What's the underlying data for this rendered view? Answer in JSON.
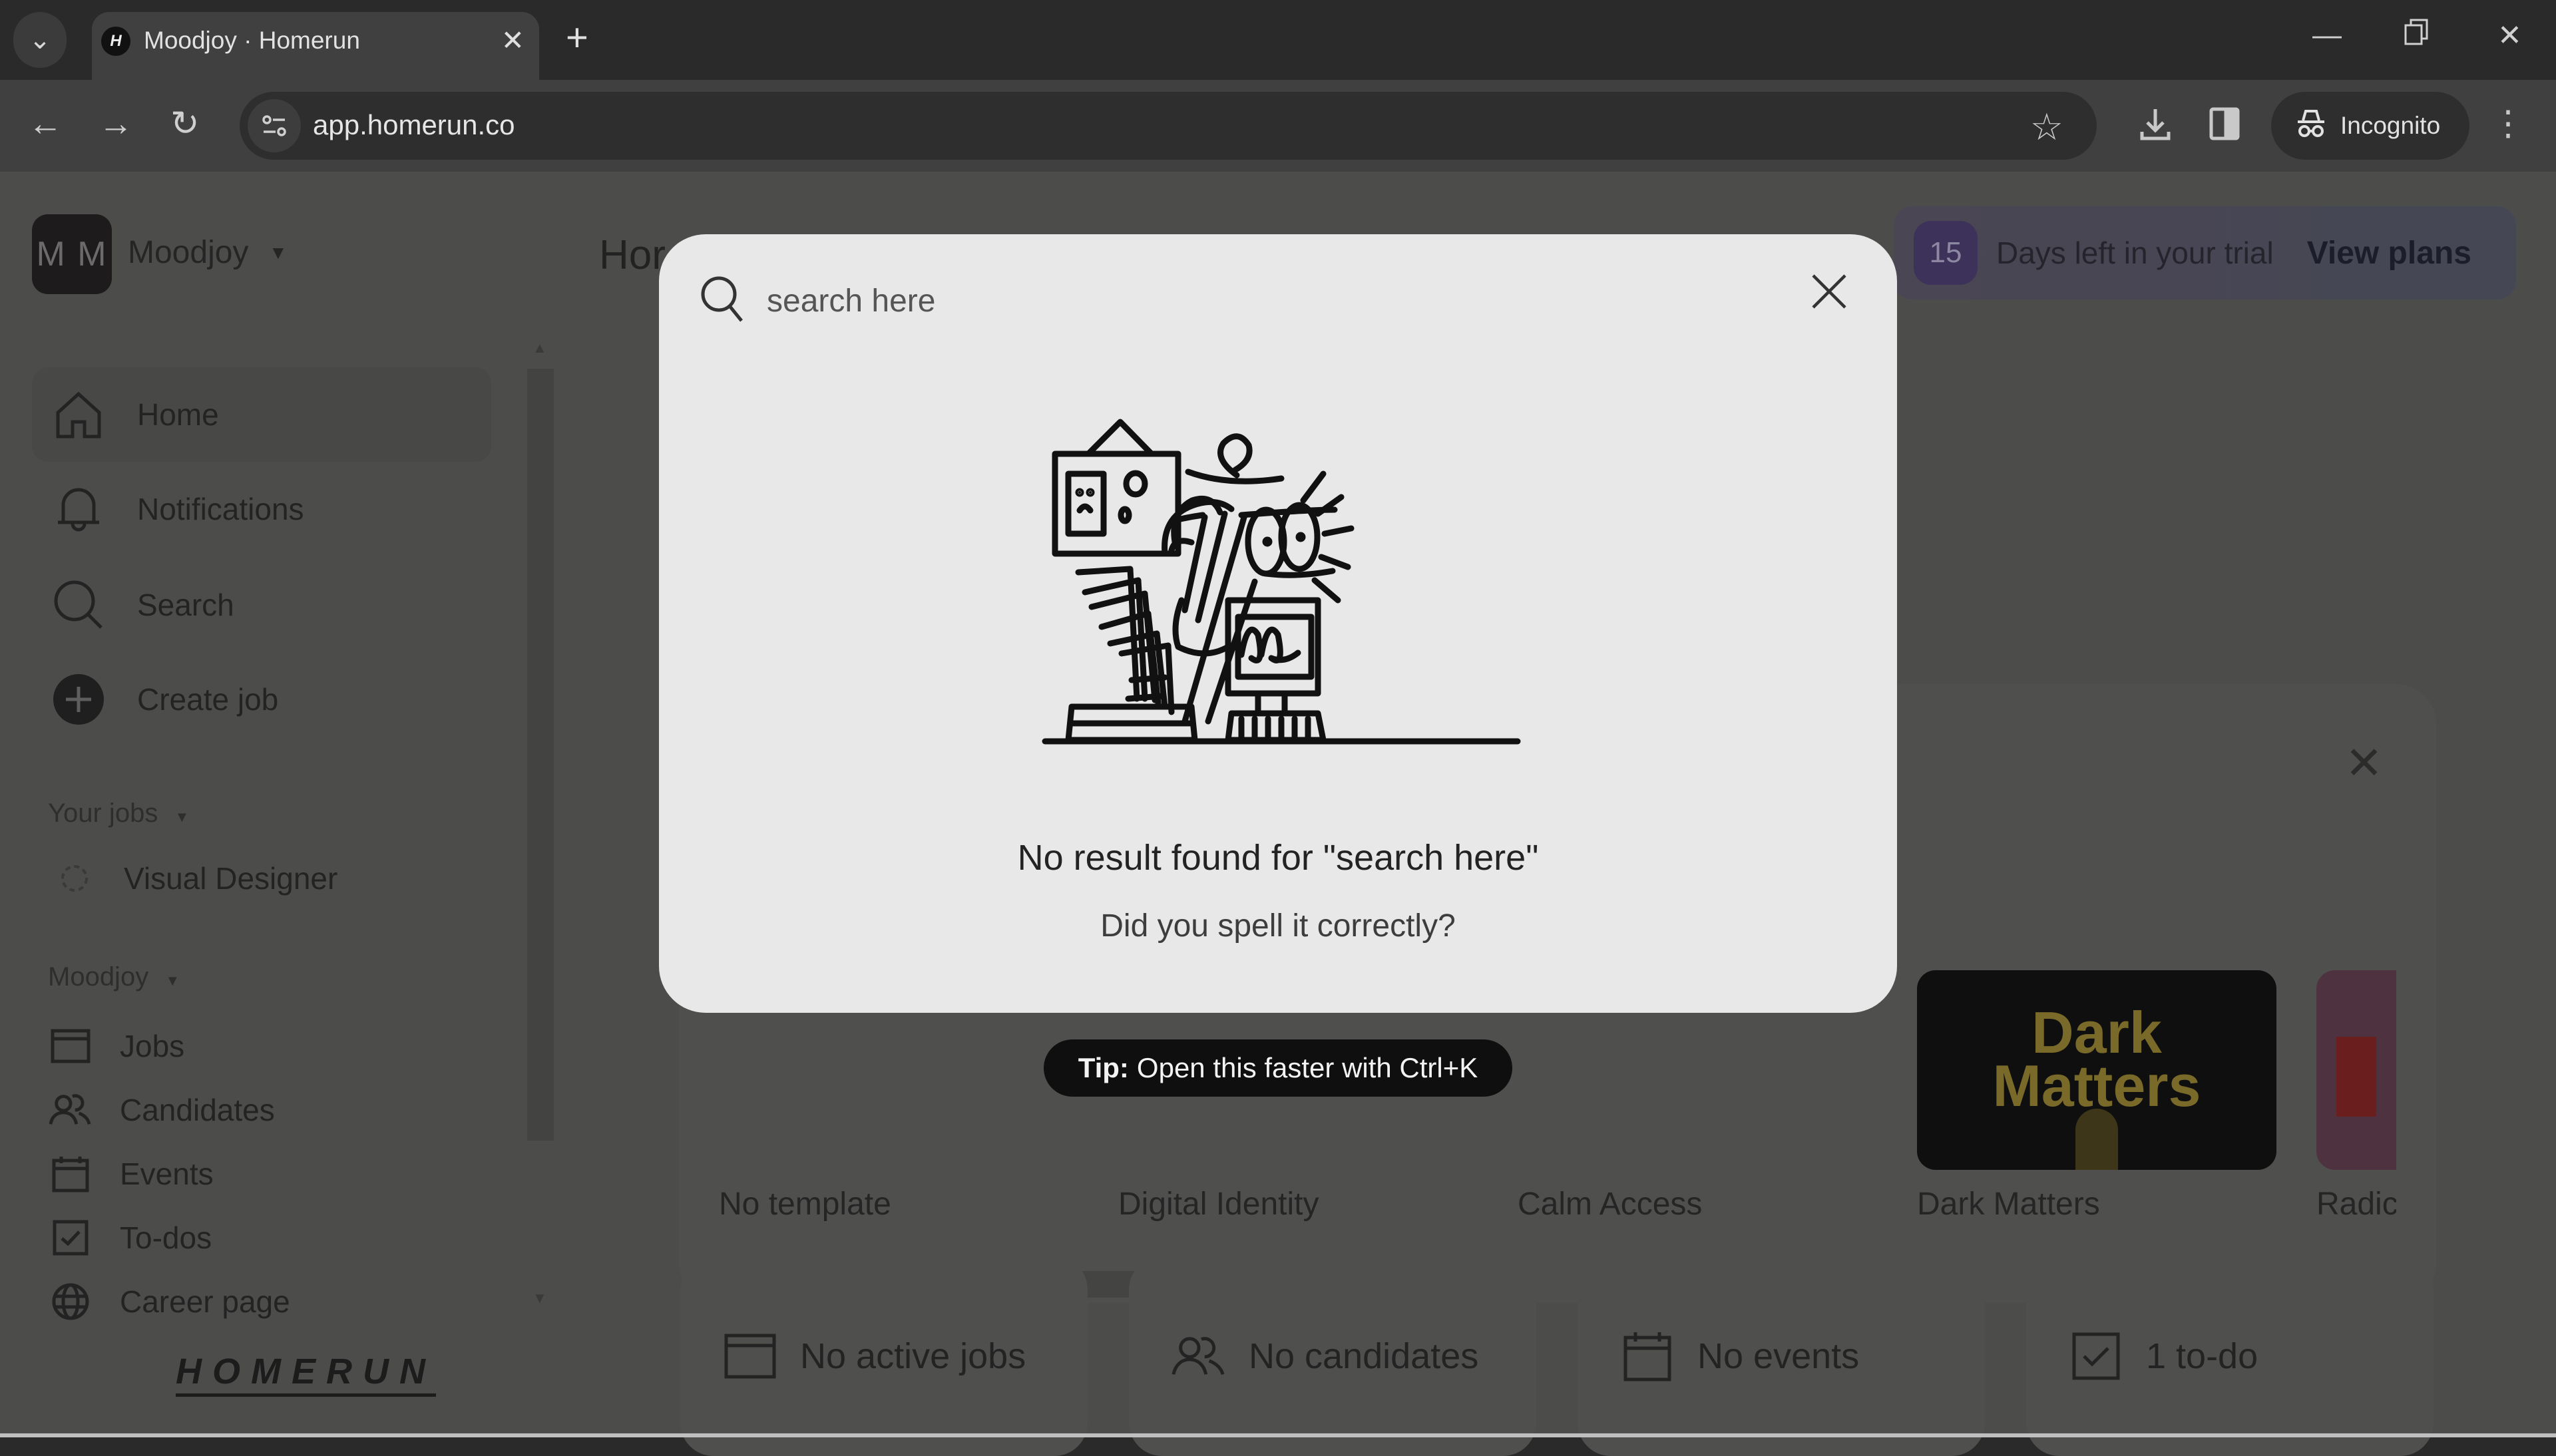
{
  "browser": {
    "tab_title": "Moodjoy · Homerun",
    "favicon_letter": "H",
    "url": "app.homerun.co",
    "profile_label": "Incognito",
    "icons": {
      "tab_search": "chevron-down-icon",
      "new_tab": "plus-icon",
      "back": "arrow-left-icon",
      "forward": "arrow-right-icon",
      "reload": "reload-icon",
      "site_info": "tune-icon",
      "bookmark": "star-icon",
      "download": "download-icon",
      "side_panel": "side-panel-icon",
      "menu": "kebab-menu-icon"
    }
  },
  "sidebar": {
    "org_initials": "M M",
    "org_name": "Moodjoy",
    "primary_nav": [
      {
        "label": "Home",
        "icon": "home-icon",
        "active": true
      },
      {
        "label": "Notifications",
        "icon": "bell-icon",
        "active": false
      },
      {
        "label": "Search",
        "icon": "search-icon",
        "active": false
      },
      {
        "label": "Create job",
        "icon": "plus-circle-icon",
        "active": false
      }
    ],
    "your_jobs_label": "Your jobs",
    "your_jobs": [
      {
        "label": "Visual Designer",
        "icon": "dashed-circle-icon"
      }
    ],
    "org_section_label": "Moodjoy",
    "org_nav": [
      {
        "label": "Jobs",
        "icon": "browser-window-icon"
      },
      {
        "label": "Candidates",
        "icon": "users-icon"
      },
      {
        "label": "Events",
        "icon": "calendar-icon"
      },
      {
        "label": "To-dos",
        "icon": "checkbox-icon"
      },
      {
        "label": "Career page",
        "icon": "globe-icon"
      }
    ],
    "logo_text": "HOMERUN"
  },
  "main": {
    "page_title": "Hor",
    "trial": {
      "days": "15",
      "text": "Days left in your trial",
      "link": "View plans"
    },
    "templates": [
      {
        "label": "No template"
      },
      {
        "label": "Digital Identity"
      },
      {
        "label": "Calm Access"
      },
      {
        "label": "Dark Matters",
        "thumb_text_1": "Dark",
        "thumb_text_2": "Matters"
      },
      {
        "label": "Radic"
      }
    ],
    "stats": [
      {
        "label": "No active jobs",
        "icon": "browser-window-icon"
      },
      {
        "label": "No candidates",
        "icon": "users-icon"
      },
      {
        "label": "No events",
        "icon": "calendar-icon"
      },
      {
        "label": "1 to-do",
        "icon": "checkbox-icon"
      }
    ]
  },
  "search_modal": {
    "input_value": "",
    "placeholder": "search here",
    "empty_title": "No result found for \"search here\"",
    "empty_subtitle": "Did you spell it correctly?",
    "illustration": "person-with-binoculars-illustration"
  },
  "tip": {
    "prefix": "Tip:",
    "text": "Open this faster with Ctrl+K"
  },
  "colors": {
    "modal_bg": "#e8e8e8",
    "overlay_bg": "#4c4d4b",
    "tip_bg": "#0f0f0f",
    "trial_badge": "#3d3259",
    "dark_matters_text": "#7a6a2a"
  }
}
